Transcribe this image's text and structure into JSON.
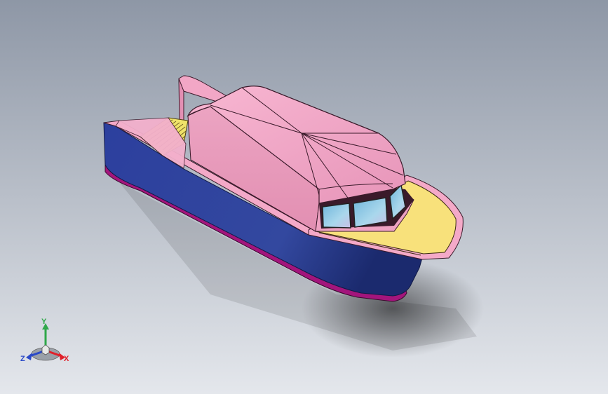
{
  "viewport": {
    "background_top": "#8e97a6",
    "background_bottom": "#e4e7ec"
  },
  "model": {
    "hull_color": "#2f45a6",
    "keel_color": "#a3157c",
    "deck_color": "#f8e17b",
    "cabin_color": "#f2a7c6",
    "window_color": "#8ec5e3",
    "decking_color": "#f0e36a"
  },
  "triad": {
    "x_label": "X",
    "y_label": "Y",
    "z_label": "Z",
    "x_color": "#e0202a",
    "y_color": "#2fa84a",
    "z_color": "#2a49c8"
  }
}
